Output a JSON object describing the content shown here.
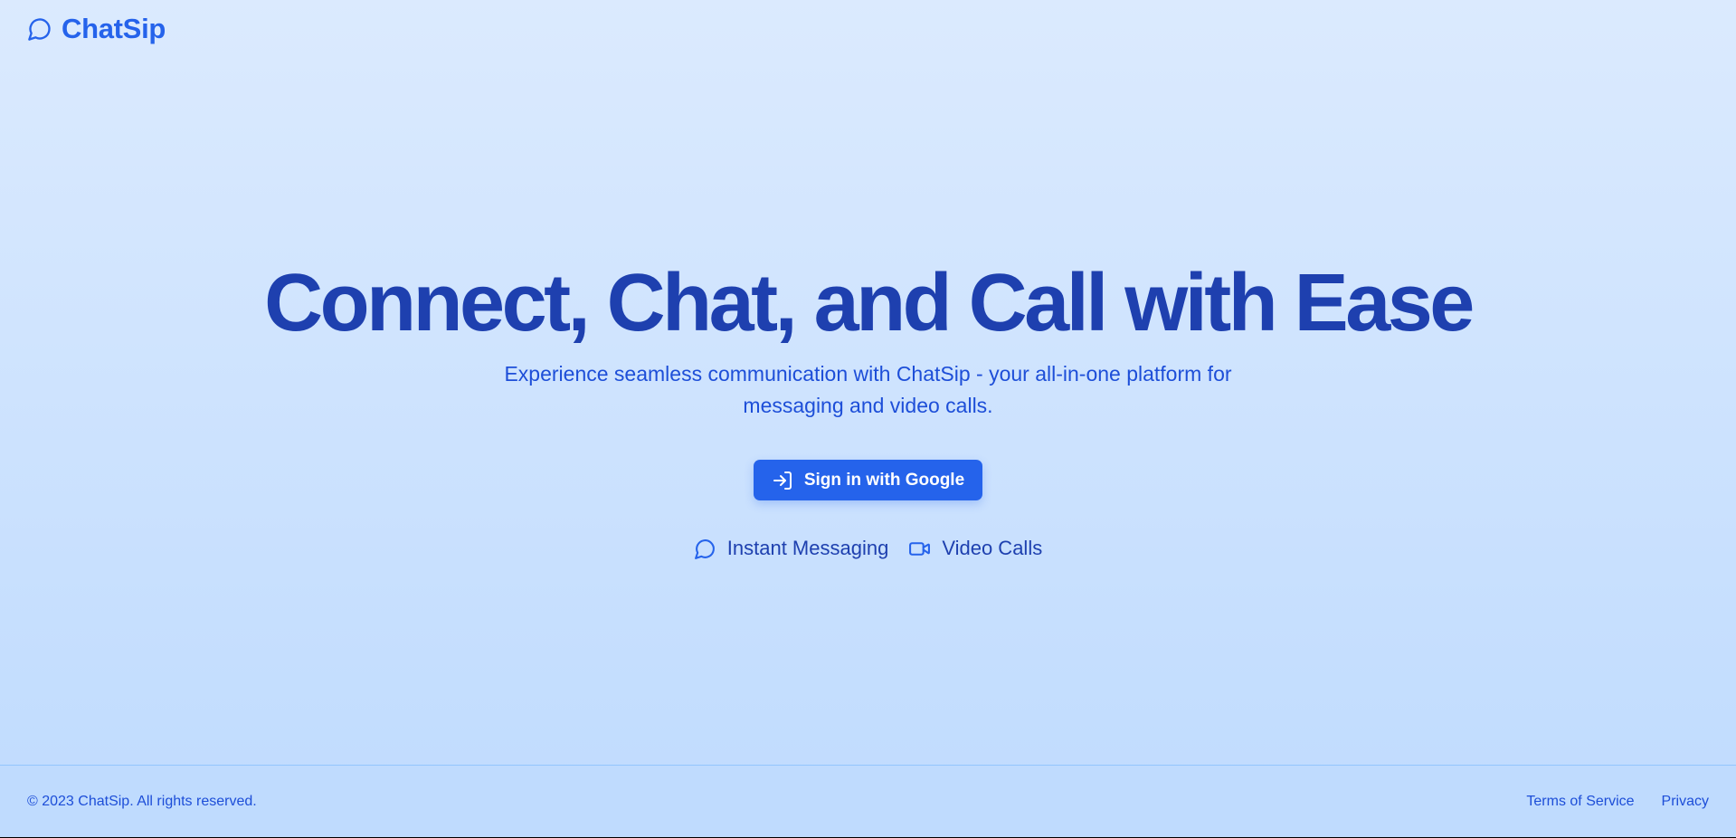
{
  "header": {
    "brand": "ChatSip",
    "logo_icon": "message-circle-icon"
  },
  "hero": {
    "title": "Connect, Chat, and Call with Ease",
    "subtitle": "Experience seamless communication with ChatSip - your all-in-one platform for messaging and video calls.",
    "cta": {
      "label": "Sign in with Google",
      "icon": "log-in-icon"
    },
    "features": [
      {
        "label": "Instant Messaging",
        "icon": "message-circle-icon"
      },
      {
        "label": "Video Calls",
        "icon": "video-camera-icon"
      }
    ]
  },
  "footer": {
    "copyright": "© 2023 ChatSip. All rights reserved.",
    "links": [
      {
        "label": "Terms of Service"
      },
      {
        "label": "Privacy"
      }
    ]
  },
  "colors": {
    "accent": "#2563eb",
    "heading": "#1e40af",
    "text": "#1d4ed8",
    "background_top": "#dbeafe",
    "background_bottom": "#bfdbfe"
  }
}
